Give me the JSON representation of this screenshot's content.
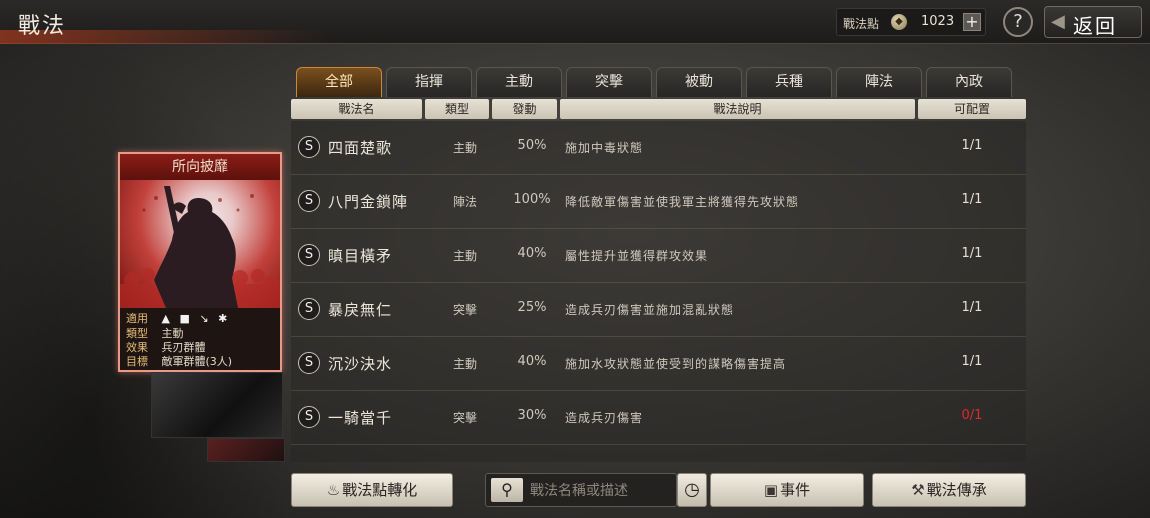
{
  "topbar": {
    "title": "戰法",
    "points_label": "戰法點",
    "points_value": "1023",
    "help": "?",
    "back_label": "返回"
  },
  "tabs": [
    "全部",
    "指揮",
    "主動",
    "突擊",
    "被動",
    "兵種",
    "陣法",
    "內政"
  ],
  "active_tab": "全部",
  "columns": {
    "name": "戰法名",
    "type": "類型",
    "rate": "發動",
    "desc": "戰法說明",
    "slot": "可配置"
  },
  "rows": [
    {
      "grade": "S",
      "name": "四面楚歌",
      "type": "主動",
      "rate": "50%",
      "desc": "施加中毒狀態",
      "slot": "1/1"
    },
    {
      "grade": "S",
      "name": "八門金鎖陣",
      "type": "陣法",
      "rate": "100%",
      "desc": "降低敵軍傷害並使我軍主將獲得先攻狀態",
      "slot": "1/1"
    },
    {
      "grade": "S",
      "name": "瞋目橫矛",
      "type": "主動",
      "rate": "40%",
      "desc": "屬性提升並獲得群攻效果",
      "slot": "1/1"
    },
    {
      "grade": "S",
      "name": "暴戾無仁",
      "type": "突擊",
      "rate": "25%",
      "desc": "造成兵刃傷害並施加混亂狀態",
      "slot": "1/1"
    },
    {
      "grade": "S",
      "name": "沉沙決水",
      "type": "主動",
      "rate": "40%",
      "desc": "施加水攻狀態並使受到的謀略傷害提高",
      "slot": "1/1"
    },
    {
      "grade": "S",
      "name": "一騎當千",
      "type": "突擊",
      "rate": "30%",
      "desc": "造成兵刃傷害",
      "slot": "0/1",
      "slot_color": "#d92c2c"
    }
  ],
  "card": {
    "title": "所向披靡",
    "info": [
      {
        "key": "適用",
        "value": ""
      },
      {
        "key": "類型",
        "value": "主動"
      },
      {
        "key": "效果",
        "value": "兵刃群體"
      },
      {
        "key": "目標",
        "value": "敵軍群體(3人)"
      }
    ]
  },
  "bottom": {
    "convert_label": "戰法點轉化",
    "search_placeholder": "戰法名稱或描述",
    "event_label": "事件",
    "inherit_label": "戰法傳承"
  }
}
